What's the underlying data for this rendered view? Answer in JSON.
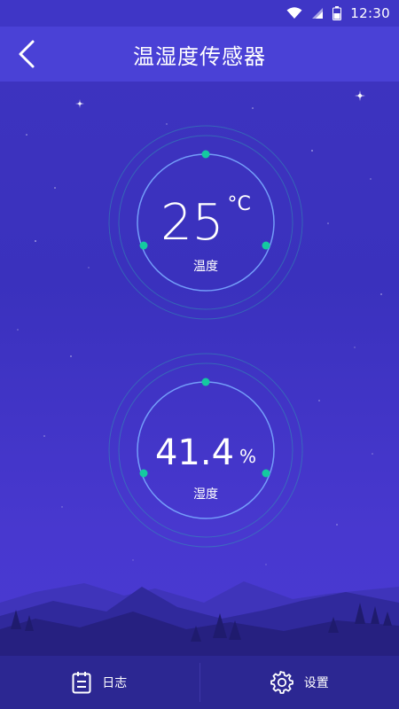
{
  "status_bar": {
    "time": "12:30",
    "icons": [
      "wifi-icon",
      "signal-icon",
      "battery-icon"
    ]
  },
  "header": {
    "title": "温湿度传感器",
    "back_icon": "chevron-left-icon"
  },
  "temperature": {
    "value": "25",
    "unit": "°C",
    "label": "温度"
  },
  "humidity": {
    "value": "41.4",
    "unit": "%",
    "label": "湿度"
  },
  "bottom_nav": {
    "log_label": "日志",
    "log_icon": "notepad-icon",
    "settings_label": "设置",
    "settings_icon": "gear-icon"
  },
  "colors": {
    "background": "#3e34c0",
    "header": "#4a41d6",
    "ring": "#7aa8ff",
    "dot": "#14c9a0",
    "bottom_bar": "#2c2792"
  }
}
